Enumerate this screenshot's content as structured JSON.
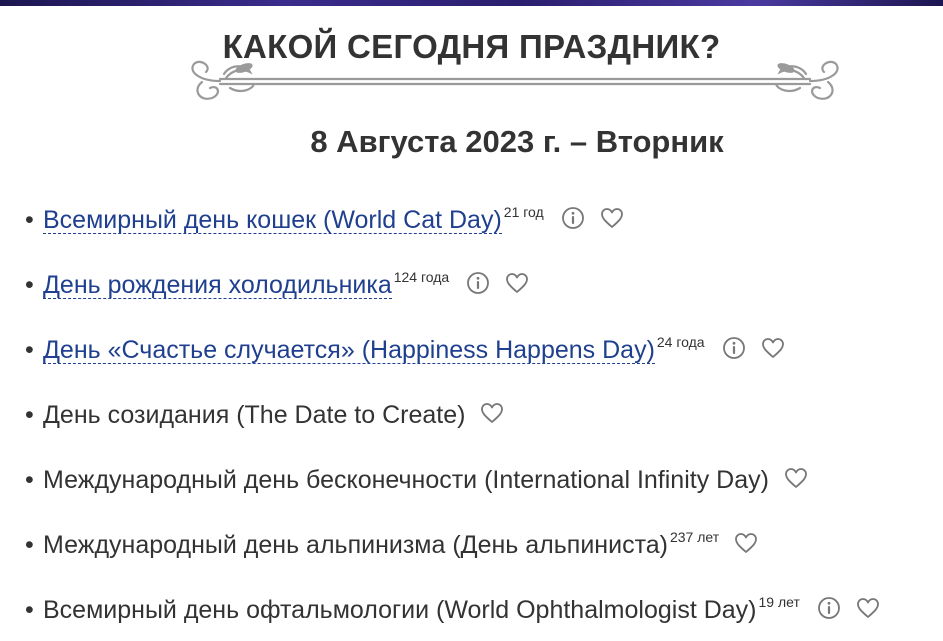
{
  "header": {
    "title": "КАКОЙ СЕГОДНЯ ПРАЗДНИК?",
    "date": "8 Августа 2023 г. – Вторник"
  },
  "holidays": [
    {
      "name": "Всемирный день кошек (World Cat Day)",
      "linked": true,
      "age": "21 год",
      "has_info": true
    },
    {
      "name": "День рождения холодильника",
      "linked": true,
      "age": "124 года",
      "has_info": true
    },
    {
      "name": "День «Счастье случается» (Happiness Happens Day)",
      "linked": true,
      "age": "24 года",
      "has_info": true
    },
    {
      "name": "День созидания (The Date to Create)",
      "linked": false,
      "age": "",
      "has_info": false
    },
    {
      "name": "Международный день бесконечности (International Infinity Day)",
      "linked": false,
      "age": "",
      "has_info": false
    },
    {
      "name": "Международный день альпинизма (День альпиниста)",
      "linked": false,
      "age": "237 лет",
      "has_info": false
    },
    {
      "name": "Всемирный день офтальмологии (World Ophthalmologist Day)",
      "linked": false,
      "age": "19 лет",
      "has_info": true
    }
  ],
  "icons": {
    "info": "info-circle-icon",
    "favorite": "heart-outline-icon",
    "ornament": "flourish-divider-icon"
  },
  "colors": {
    "link": "#1f3f8f",
    "text": "#333333",
    "icon": "#777777",
    "top_strip": "#2a1e6e"
  }
}
